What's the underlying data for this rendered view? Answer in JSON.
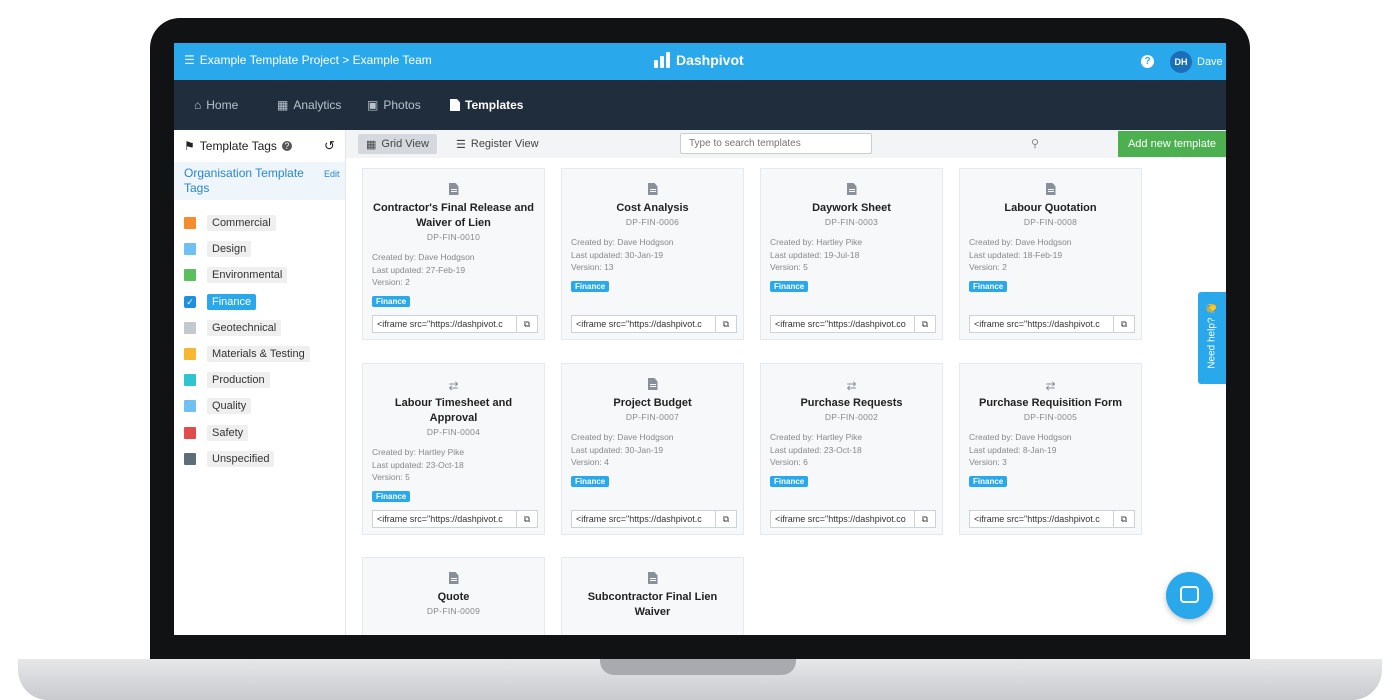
{
  "topbar": {
    "breadcrumb": "Example Template Project > Example Team",
    "brand": "Dashpivot",
    "help_icon": "question-circle-icon",
    "avatar_initials": "DH",
    "user_name": "Dave",
    "color": "#29a8eb"
  },
  "nav": {
    "items": [
      {
        "label": "Home",
        "icon": "home-icon"
      },
      {
        "label": "Analytics",
        "icon": "bar-chart-icon"
      },
      {
        "label": "Photos",
        "icon": "camera-icon"
      },
      {
        "label": "Templates",
        "icon": "document-icon"
      }
    ],
    "active": "Templates"
  },
  "sidebar": {
    "heading": "Template Tags",
    "org_label": "Organisation Template Tags",
    "edit_label": "Edit",
    "tags": [
      {
        "label": "Commercial",
        "color": "#f58b2b"
      },
      {
        "label": "Design",
        "color": "#6ec1f2"
      },
      {
        "label": "Environmental",
        "color": "#5cbf5e"
      },
      {
        "label": "Finance",
        "color": "#1e90e0",
        "checked": true
      },
      {
        "label": "Geotechnical",
        "color": "#c3c9d0"
      },
      {
        "label": "Materials & Testing",
        "color": "#f7b731"
      },
      {
        "label": "Production",
        "color": "#2ec4d0"
      },
      {
        "label": "Quality",
        "color": "#6ec1f2"
      },
      {
        "label": "Safety",
        "color": "#e24b4b"
      },
      {
        "label": "Unspecified",
        "color": "#5d6d7a"
      }
    ]
  },
  "toolbar": {
    "grid_view": "Grid View",
    "register_view": "Register View",
    "search_placeholder": "Type to search templates",
    "add_button": "Add new template",
    "add_color": "#4cb050"
  },
  "templates": [
    {
      "icon": "document-icon",
      "title": "Contractor's Final Release and Waiver of Lien",
      "code": "DP-FIN-0010",
      "created_by": "Created by: Dave Hodgson",
      "updated": "Last updated: 27-Feb-19",
      "version": "Version: 2",
      "tag": "Finance",
      "embed": "<iframe src=\"https://dashpivot.c"
    },
    {
      "icon": "document-icon",
      "title": "Cost Analysis",
      "code": "DP-FIN-0006",
      "created_by": "Created by: Dave Hodgson",
      "updated": "Last updated: 30-Jan-19",
      "version": "Version: 13",
      "tag": "Finance",
      "embed": "<iframe src=\"https://dashpivot.c"
    },
    {
      "icon": "document-icon",
      "title": "Daywork Sheet",
      "code": "DP-FIN-0003",
      "created_by": "Created by: Hartley Pike",
      "updated": "Last updated: 19-Jul-18",
      "version": "Version: 5",
      "tag": "Finance",
      "embed": "<iframe src=\"https://dashpivot.co"
    },
    {
      "icon": "document-icon",
      "title": "Labour Quotation",
      "code": "DP-FIN-0008",
      "created_by": "Created by: Dave Hodgson",
      "updated": "Last updated: 18-Feb-19",
      "version": "Version: 2",
      "tag": "Finance",
      "embed": "<iframe src=\"https://dashpivot.c"
    },
    {
      "icon": "shuffle-icon",
      "title": "Labour Timesheet and Approval",
      "code": "DP-FIN-0004",
      "created_by": "Created by: Hartley Pike",
      "updated": "Last updated: 23-Oct-18",
      "version": "Version: 5",
      "tag": "Finance",
      "embed": "<iframe src=\"https://dashpivot.c"
    },
    {
      "icon": "document-icon",
      "title": "Project Budget",
      "code": "DP-FIN-0007",
      "created_by": "Created by: Dave Hodgson",
      "updated": "Last updated: 30-Jan-19",
      "version": "Version: 4",
      "tag": "Finance",
      "embed": "<iframe src=\"https://dashpivot.c"
    },
    {
      "icon": "shuffle-icon",
      "title": "Purchase Requests",
      "code": "DP-FIN-0002",
      "created_by": "Created by: Hartley Pike",
      "updated": "Last updated: 23-Oct-18",
      "version": "Version: 6",
      "tag": "Finance",
      "embed": "<iframe src=\"https://dashpivot.co"
    },
    {
      "icon": "shuffle-icon",
      "title": "Purchase Requisition Form",
      "code": "DP-FIN-0005",
      "created_by": "Created by: Dave Hodgson",
      "updated": "Last updated: 8-Jan-19",
      "version": "Version: 3",
      "tag": "Finance",
      "embed": "<iframe src=\"https://dashpivot.c"
    },
    {
      "icon": "document-icon",
      "title": "Quote",
      "code": "DP-FIN-0009",
      "created_by": "",
      "updated": "",
      "version": "",
      "tag": "",
      "embed": ""
    },
    {
      "icon": "document-icon",
      "title": "Subcontractor Final Lien Waiver",
      "code": "",
      "created_by": "",
      "updated": "",
      "version": "",
      "tag": "",
      "embed": ""
    }
  ],
  "floating": {
    "need_help": "Need help? 👋",
    "chat_icon": "chat-icon"
  }
}
